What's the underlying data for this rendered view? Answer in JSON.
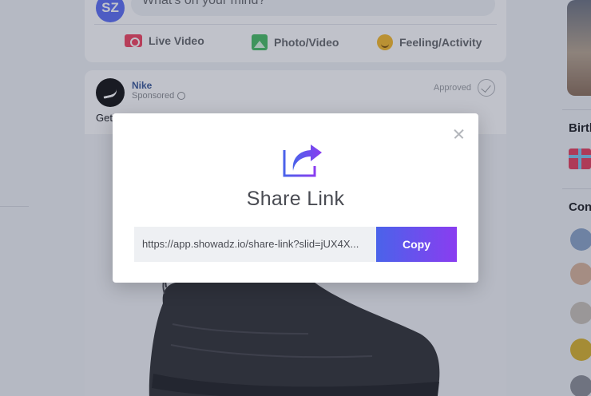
{
  "composer": {
    "avatar_initials": "SZ",
    "placeholder": "What's on your mind?",
    "actions": [
      {
        "label": "Live Video",
        "icon": "live-video-icon"
      },
      {
        "label": "Photo/Video",
        "icon": "photo-video-icon"
      },
      {
        "label": "Feeling/Activity",
        "icon": "feeling-activity-icon"
      }
    ]
  },
  "post": {
    "brand": "Nike",
    "sponsored": "Sponsored",
    "status": "Approved",
    "caption_start": "Get"
  },
  "sidebar": {
    "birthdays_heading": "Birth",
    "contacts_heading": "Con"
  },
  "modal": {
    "title": "Share Link",
    "link": "https://app.showadz.io/share-link?slid=jUX4X...",
    "copy_label": "Copy",
    "accent_start": "#4a63ea",
    "accent_end": "#8a3df0"
  }
}
